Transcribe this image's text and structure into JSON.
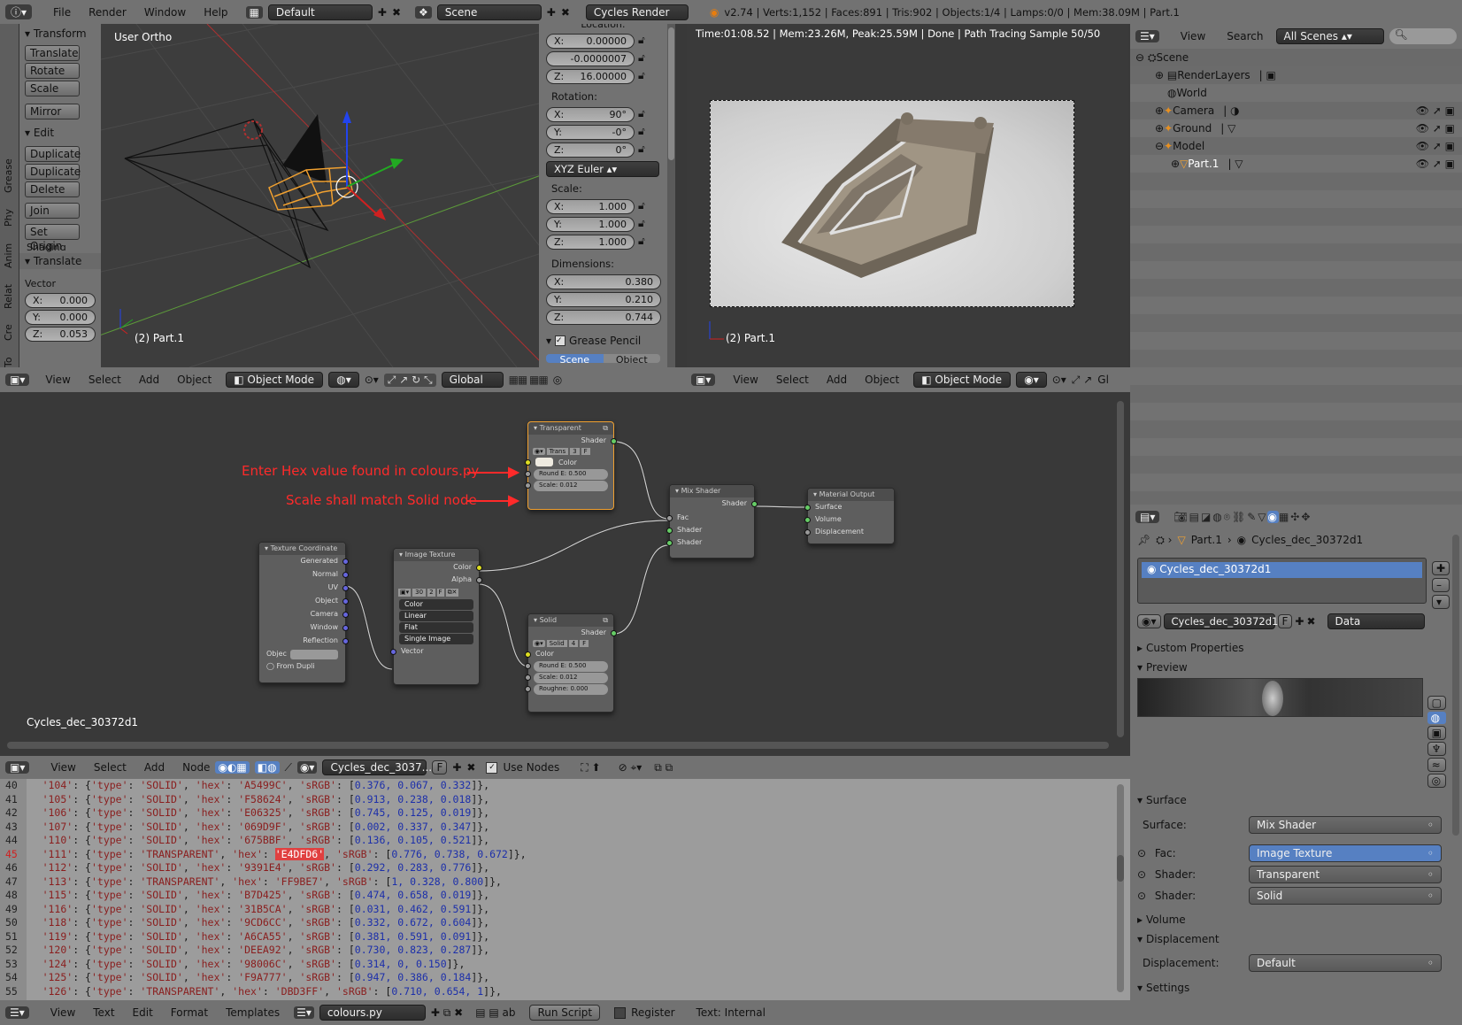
{
  "info_header": {
    "menus": [
      "File",
      "Render",
      "Window",
      "Help"
    ],
    "screen_layout": "Default",
    "scene": "Scene",
    "engine": "Cycles Render",
    "stats": "v2.74 | Verts:1,152 | Faces:891 | Tris:902 | Objects:1/4 | Lamps:0/0 | Mem:38.09M | Part.1"
  },
  "tool_shelf": {
    "tabs": [
      "To",
      "Cre",
      "Relat",
      "Anim",
      "Phy",
      "Grease"
    ],
    "transform_title": "Transform",
    "transform_buttons": [
      "Translate",
      "Rotate",
      "Scale",
      "Mirror"
    ],
    "edit_title": "Edit",
    "edit_buttons": [
      "Duplicate",
      "Duplicate",
      "Delete",
      "Join",
      "Set Origin"
    ],
    "shading_partial": "Shading",
    "operator_title": "Translate",
    "vector_label": "Vector",
    "vector": [
      {
        "l": "X:",
        "v": "0.000"
      },
      {
        "l": "Y:",
        "v": "0.000"
      },
      {
        "l": "Z:",
        "v": "0.053"
      }
    ]
  },
  "viewport3d": {
    "view_label": "User Ortho",
    "object_label": "(2) Part.1",
    "menus": [
      "View",
      "Select",
      "Add",
      "Object"
    ],
    "mode": "Object Mode",
    "orientation": "Global"
  },
  "properties_n": {
    "location_label": "Location:",
    "location": [
      {
        "l": "X:",
        "v": "0.00000"
      },
      {
        "l": "",
        "v": "-0.0000007"
      },
      {
        "l": "Z:",
        "v": "16.00000"
      }
    ],
    "rotation_label": "Rotation:",
    "rotation": [
      {
        "l": "X:",
        "v": "90°"
      },
      {
        "l": "Y:",
        "v": "-0°"
      },
      {
        "l": "Z:",
        "v": "0°"
      }
    ],
    "rotation_mode": "XYZ Euler",
    "scale_label": "Scale:",
    "scale": [
      {
        "l": "X:",
        "v": "1.000"
      },
      {
        "l": "Y:",
        "v": "1.000"
      },
      {
        "l": "Z:",
        "v": "1.000"
      }
    ],
    "dimensions_label": "Dimensions:",
    "dimensions": [
      {
        "l": "X:",
        "v": "0.380"
      },
      {
        "l": "Y:",
        "v": "0.210"
      },
      {
        "l": "Z:",
        "v": "0.744"
      }
    ],
    "grease_pencil": "Grease Pencil",
    "gp_tabs": [
      "Scene",
      "Object"
    ]
  },
  "render_view": {
    "status": "Time:01:08.52 | Mem:23.26M, Peak:25.59M | Done | Path Tracing Sample 50/50",
    "object_label": "(2) Part.1",
    "menus": [
      "View",
      "Select",
      "Add",
      "Object"
    ],
    "mode": "Object Mode",
    "partial": "Gl"
  },
  "outliner": {
    "menus": [
      "View",
      "Search"
    ],
    "filter": "All Scenes",
    "items": [
      "Scene",
      "RenderLayers",
      "World",
      "Camera",
      "Ground",
      "Model",
      "Part.1"
    ]
  },
  "node_editor": {
    "material_name_overlay": "Cycles_dec_30372d1",
    "menus": [
      "View",
      "Select",
      "Add",
      "Node"
    ],
    "material": "Cycles_dec_3037...",
    "use_nodes": "Use Nodes",
    "annotations": [
      "Enter Hex value found in colours.py",
      "Scale shall match Solid node"
    ],
    "nodes": {
      "transparent": {
        "title": "Transparent",
        "out": "Shader",
        "group": "Trans",
        "users": "3",
        "fake": "F",
        "color": "Color",
        "round": "Round E: 0.500",
        "scale": "Scale:   0.012"
      },
      "mix": {
        "title": "Mix Shader",
        "out": "Shader",
        "in": [
          "Fac",
          "Shader",
          "Shader"
        ]
      },
      "output": {
        "title": "Material Output",
        "in": [
          "Surface",
          "Volume",
          "Displacement"
        ]
      },
      "texcoord": {
        "title": "Texture Coordinate",
        "outs": [
          "Generated",
          "Normal",
          "UV",
          "Object",
          "Camera",
          "Window",
          "Reflection"
        ],
        "obj": "Objec",
        "dupli": "From Dupli"
      },
      "image": {
        "title": "Image Texture",
        "outs": [
          "Color",
          "Alpha"
        ],
        "num": "30",
        "users": "2",
        "fake": "F",
        "opts": [
          "Color",
          "Linear",
          "Flat",
          "Single Image"
        ],
        "vector": "Vector"
      },
      "solid": {
        "title": "Solid",
        "out": "Shader",
        "group": "Solid",
        "users": "4",
        "fake": "F",
        "color": "Color",
        "round": "Round E: 0.500",
        "scale": "Scale:   0.012",
        "rough": "Roughne: 0.000"
      }
    }
  },
  "text_editor": {
    "menus": [
      "View",
      "Text",
      "Edit",
      "Format",
      "Templates"
    ],
    "file": "colours.py",
    "run": "Run Script",
    "register": "Register",
    "internal": "Text: Internal",
    "lines": [
      {
        "n": "40",
        "key": "'104'",
        "type": "'SOLID'",
        "hex": "'A5499C'",
        "rgb": "0.376, 0.067, 0.332"
      },
      {
        "n": "41",
        "key": "'105'",
        "type": "'SOLID'",
        "hex": "'F58624'",
        "rgb": "0.913, 0.238, 0.018"
      },
      {
        "n": "42",
        "key": "'106'",
        "type": "'SOLID'",
        "hex": "'E06325'",
        "rgb": "0.745, 0.125, 0.019"
      },
      {
        "n": "43",
        "key": "'107'",
        "type": "'SOLID'",
        "hex": "'069D9F'",
        "rgb": "0.002, 0.337, 0.347"
      },
      {
        "n": "44",
        "key": "'110'",
        "type": "'SOLID'",
        "hex": "'675BBF'",
        "rgb": "0.136, 0.105, 0.521"
      },
      {
        "n": "45",
        "key": "'111'",
        "type": "'TRANSPARENT'",
        "hex": "'E4DFD6'",
        "rgb": "0.776, 0.738, 0.672",
        "hl": true
      },
      {
        "n": "46",
        "key": "'112'",
        "type": "'SOLID'",
        "hex": "'9391E4'",
        "rgb": "0.292, 0.283, 0.776"
      },
      {
        "n": "47",
        "key": "'113'",
        "type": "'TRANSPARENT'",
        "hex": "'FF9BE7'",
        "rgb": "1, 0.328, 0.800"
      },
      {
        "n": "48",
        "key": "'115'",
        "type": "'SOLID'",
        "hex": "'B7D425'",
        "rgb": "0.474, 0.658, 0.019"
      },
      {
        "n": "49",
        "key": "'116'",
        "type": "'SOLID'",
        "hex": "'31B5CA'",
        "rgb": "0.031, 0.462, 0.591"
      },
      {
        "n": "50",
        "key": "'118'",
        "type": "'SOLID'",
        "hex": "'9CD6CC'",
        "rgb": "0.332, 0.672, 0.604"
      },
      {
        "n": "51",
        "key": "'119'",
        "type": "'SOLID'",
        "hex": "'A6CA55'",
        "rgb": "0.381, 0.591, 0.091"
      },
      {
        "n": "52",
        "key": "'120'",
        "type": "'SOLID'",
        "hex": "'DEEA92'",
        "rgb": "0.730, 0.823, 0.287"
      },
      {
        "n": "53",
        "key": "'124'",
        "type": "'SOLID'",
        "hex": "'98006C'",
        "rgb": "0.314, 0, 0.150"
      },
      {
        "n": "54",
        "key": "'125'",
        "type": "'SOLID'",
        "hex": "'F9A777'",
        "rgb": "0.947, 0.386, 0.184"
      },
      {
        "n": "55",
        "key": "'126'",
        "type": "'TRANSPARENT'",
        "hex": "'DBD3FF'",
        "rgb": "0.710, 0.654, 1"
      }
    ]
  },
  "material_props": {
    "breadcrumb": [
      "Part.1",
      "Cycles_dec_30372d1"
    ],
    "slot": "Cycles_dec_30372d1",
    "datablock": "Cycles_dec_30372d1",
    "fake": "F",
    "link": "Data",
    "sections": {
      "custom": "Custom Properties",
      "preview": "Preview",
      "surface": "Surface",
      "volume": "Volume",
      "displacement": "Displacement",
      "settings": "Settings"
    },
    "surface_rows": [
      {
        "l": "Surface:",
        "v": "Mix Shader"
      },
      {
        "l": "Fac:",
        "v": "Image Texture"
      },
      {
        "l": "Shader:",
        "v": "Transparent"
      },
      {
        "l": "Shader:",
        "v": "Solid"
      }
    ],
    "disp_row": {
      "l": "Displacement:",
      "v": "Default"
    }
  },
  "colors": {
    "accent": "#5680c2",
    "selected_orange": "#f0a030",
    "annotation_red": "#ff2a2a"
  }
}
